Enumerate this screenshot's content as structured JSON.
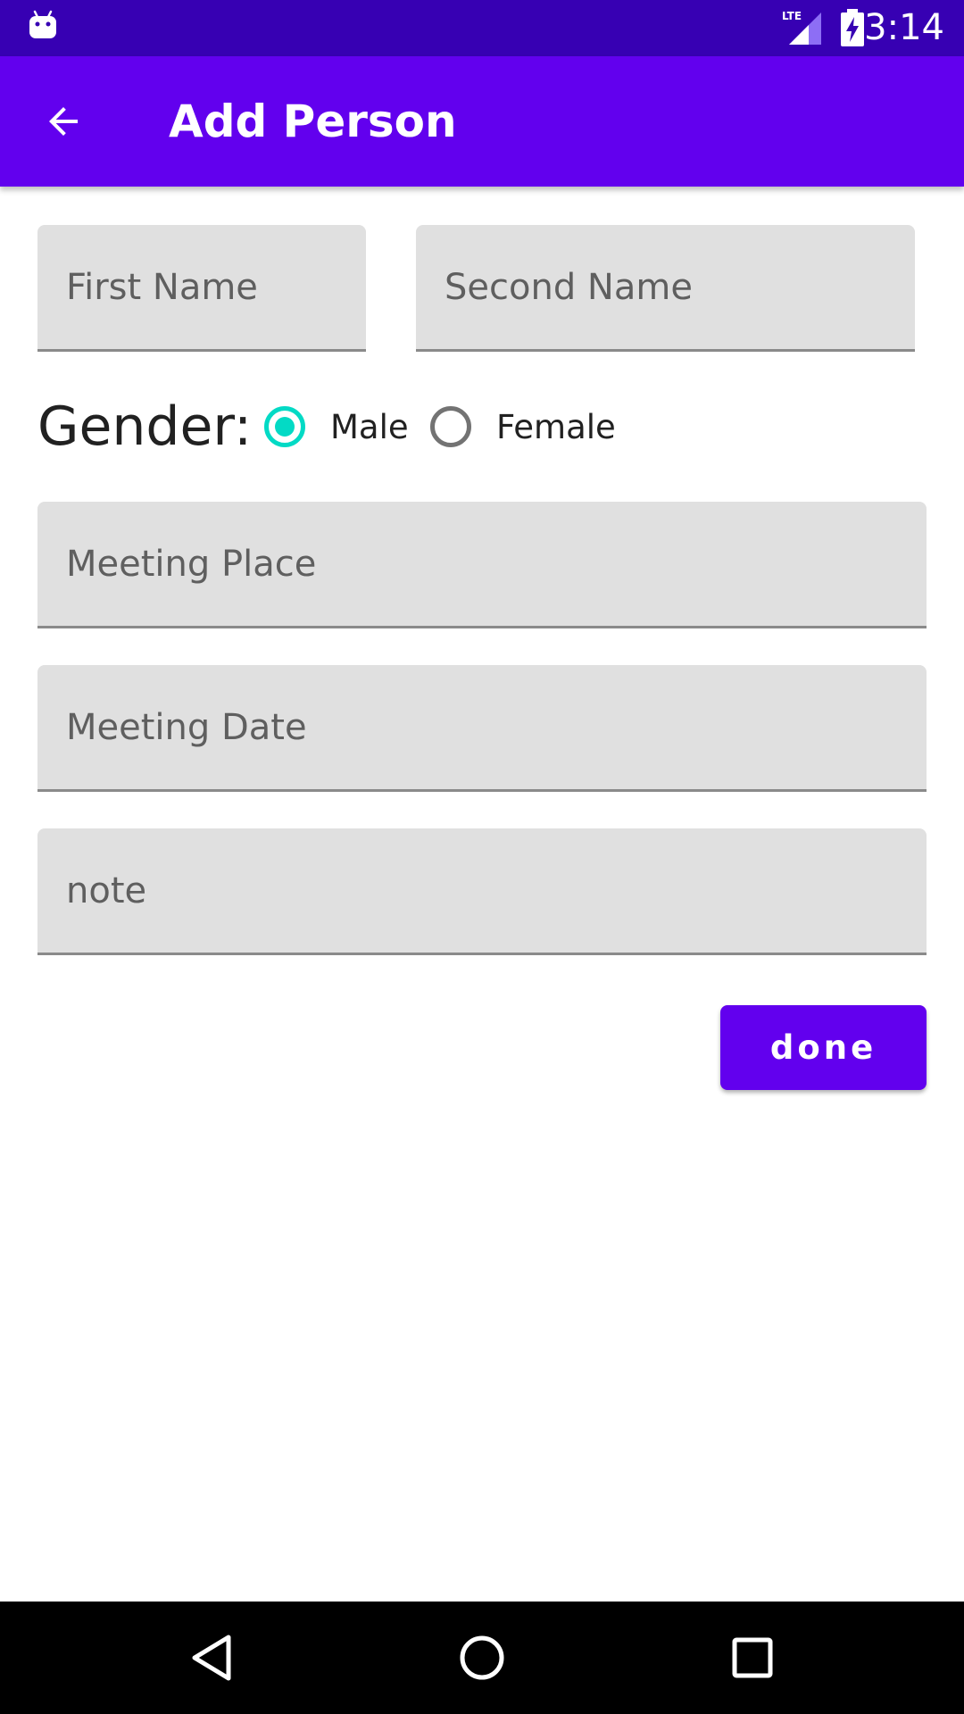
{
  "status_bar": {
    "time": "3:14",
    "icons": [
      "android-icon",
      "lte-signal-icon",
      "battery-charging-icon"
    ],
    "color": "#3700b3"
  },
  "app_bar": {
    "title": "Add Person",
    "back_icon": "arrow-back-icon",
    "color": "#6200ee"
  },
  "form": {
    "first_name": {
      "placeholder": "First Name",
      "value": ""
    },
    "second_name": {
      "placeholder": "Second Name",
      "value": ""
    },
    "gender": {
      "label": "Gender:",
      "options": [
        {
          "label": "Male",
          "selected": true
        },
        {
          "label": "Female",
          "selected": false
        }
      ],
      "accent_color": "#03dac5"
    },
    "meeting_place": {
      "placeholder": "Meeting Place",
      "value": ""
    },
    "meeting_date": {
      "placeholder": "Meeting Date",
      "value": ""
    },
    "note": {
      "placeholder": "note",
      "value": ""
    },
    "done_label": "done"
  },
  "nav_bar": {
    "icons": [
      "nav-back-icon",
      "nav-home-icon",
      "nav-recents-icon"
    ]
  }
}
